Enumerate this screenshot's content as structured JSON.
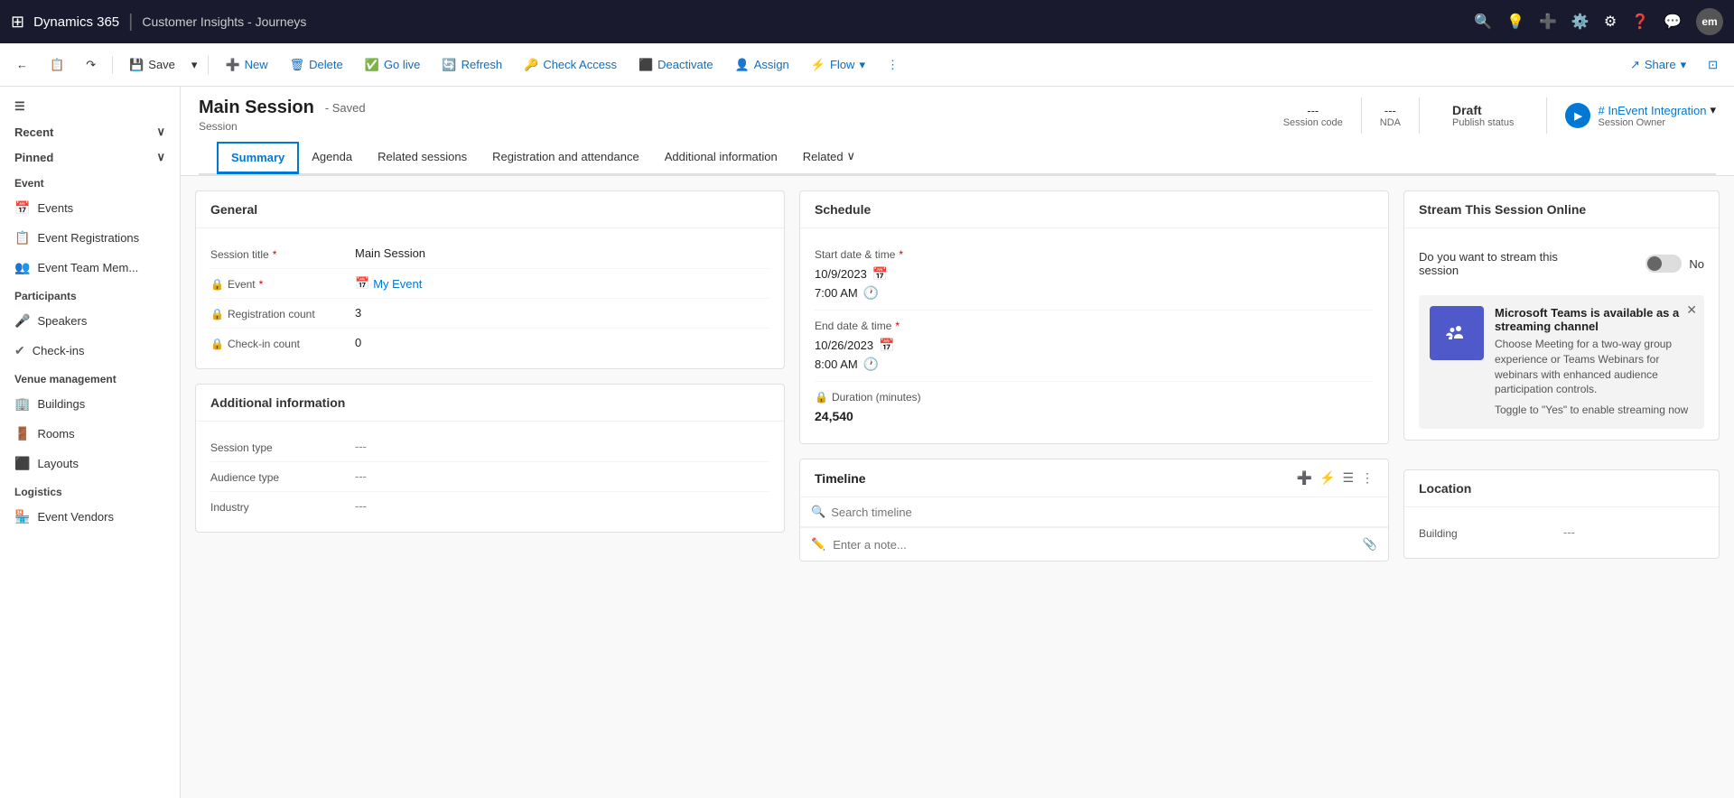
{
  "topbar": {
    "brand": "Dynamics 365",
    "separator": "|",
    "module": "Customer Insights - Journeys",
    "avatar": "em"
  },
  "commandbar": {
    "back_icon": "←",
    "page_icon": "📄",
    "forward_icon": "↷",
    "save_label": "Save",
    "save_dropdown": "▾",
    "new_label": "New",
    "delete_label": "Delete",
    "golive_label": "Go live",
    "refresh_label": "Refresh",
    "checkaccess_label": "Check Access",
    "deactivate_label": "Deactivate",
    "assign_label": "Assign",
    "flow_label": "Flow",
    "flow_dropdown": "▾",
    "more_label": "⋮",
    "share_label": "Share",
    "share_dropdown": "▾",
    "screen_icon": "⊞"
  },
  "sidebar": {
    "recent_label": "Recent",
    "pinned_label": "Pinned",
    "event_section": "Event",
    "events_label": "Events",
    "event_registrations_label": "Event Registrations",
    "event_team_label": "Event Team Mem...",
    "participants_section": "Participants",
    "speakers_label": "Speakers",
    "checkins_label": "Check-ins",
    "venue_section": "Venue management",
    "buildings_label": "Buildings",
    "rooms_label": "Rooms",
    "layouts_label": "Layouts",
    "logistics_section": "Logistics",
    "vendors_label": "Event Vendors"
  },
  "record": {
    "title": "Main Session",
    "saved_status": "- Saved",
    "entity": "Session",
    "session_code_label": "Session code",
    "session_code_value": "---",
    "nda_label": "NDA",
    "nda_value": "---",
    "publish_status_label": "Publish status",
    "publish_status_value": "Draft",
    "owner_label": "Session Owner",
    "owner_name": "# InEvent Integration",
    "owner_chevron": "▾"
  },
  "tabs": [
    {
      "label": "Summary",
      "active": true
    },
    {
      "label": "Agenda",
      "active": false
    },
    {
      "label": "Related sessions",
      "active": false
    },
    {
      "label": "Registration and attendance",
      "active": false
    },
    {
      "label": "Additional information",
      "active": false
    },
    {
      "label": "Related",
      "active": false,
      "dropdown": true
    }
  ],
  "general": {
    "section_title": "General",
    "session_title_label": "Session title",
    "session_title_value": "Main Session",
    "event_label": "Event",
    "event_value": "My Event",
    "registration_count_label": "Registration count",
    "registration_count_value": "3",
    "checkin_count_label": "Check-in count",
    "checkin_count_value": "0"
  },
  "additional_info": {
    "section_title": "Additional information",
    "session_type_label": "Session type",
    "session_type_value": "---",
    "audience_type_label": "Audience type",
    "audience_type_value": "---",
    "industry_label": "Industry",
    "industry_value": "---"
  },
  "schedule": {
    "section_title": "Schedule",
    "start_label": "Start date & time",
    "start_date": "10/9/2023",
    "start_time": "7:00 AM",
    "end_label": "End date & time",
    "end_date": "10/26/2023",
    "end_time": "8:00 AM",
    "duration_label": "Duration (minutes)",
    "duration_value": "24,540"
  },
  "timeline": {
    "title": "Timeline",
    "search_placeholder": "Search timeline",
    "note_placeholder": "Enter a note..."
  },
  "stream_online": {
    "section_title": "Stream This Session Online",
    "toggle_label": "Do you want to stream this session",
    "toggle_value": "No",
    "teams_title": "Microsoft Teams is available as a streaming channel",
    "teams_desc": "Choose Meeting for a two-way group experience or Teams Webinars for webinars with enhanced audience participation controls.",
    "teams_cta": "Toggle to \"Yes\" to enable streaming now",
    "teams_icon": "🟦"
  },
  "location": {
    "section_title": "Location",
    "building_label": "Building",
    "building_value": "---"
  }
}
